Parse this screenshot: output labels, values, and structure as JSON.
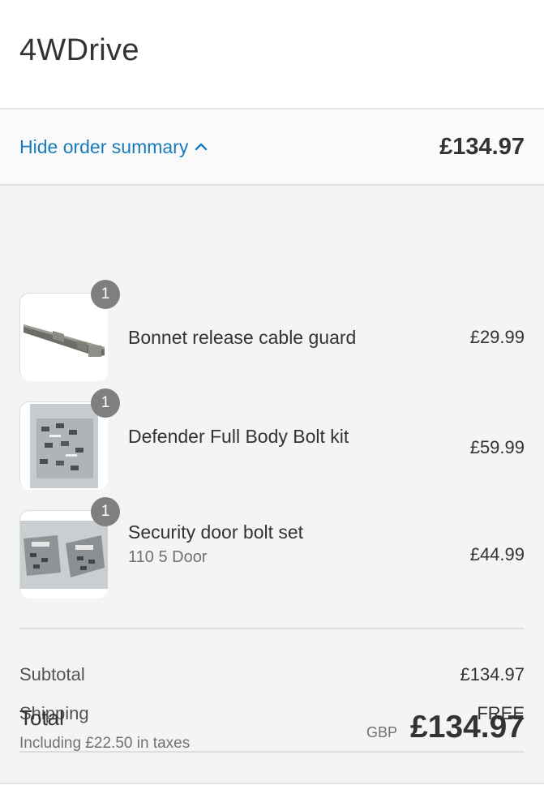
{
  "header": {
    "shop_name": "4WDrive"
  },
  "summary_toggle": {
    "label": "Hide order summary",
    "total": "£134.97"
  },
  "items": [
    {
      "quantity": "1",
      "name": "Bonnet release cable guard",
      "variant": "",
      "price": "£29.99"
    },
    {
      "quantity": "1",
      "name": "Defender Full Body Bolt kit",
      "variant": "",
      "price": "£59.99"
    },
    {
      "quantity": "1",
      "name": "Security door bolt set",
      "variant": "110 5 Door",
      "price": "£44.99"
    }
  ],
  "totals": {
    "subtotal_label": "Subtotal",
    "subtotal_value": "£134.97",
    "shipping_label": "Shipping",
    "shipping_value": "FREE",
    "total_label": "Total",
    "tax_note": "Including £22.50 in taxes",
    "currency": "GBP",
    "total_value": "£134.97"
  },
  "colors": {
    "link": "#197bbd",
    "badge": "#7f7f7f",
    "summary_bg": "#f4f4f4"
  }
}
